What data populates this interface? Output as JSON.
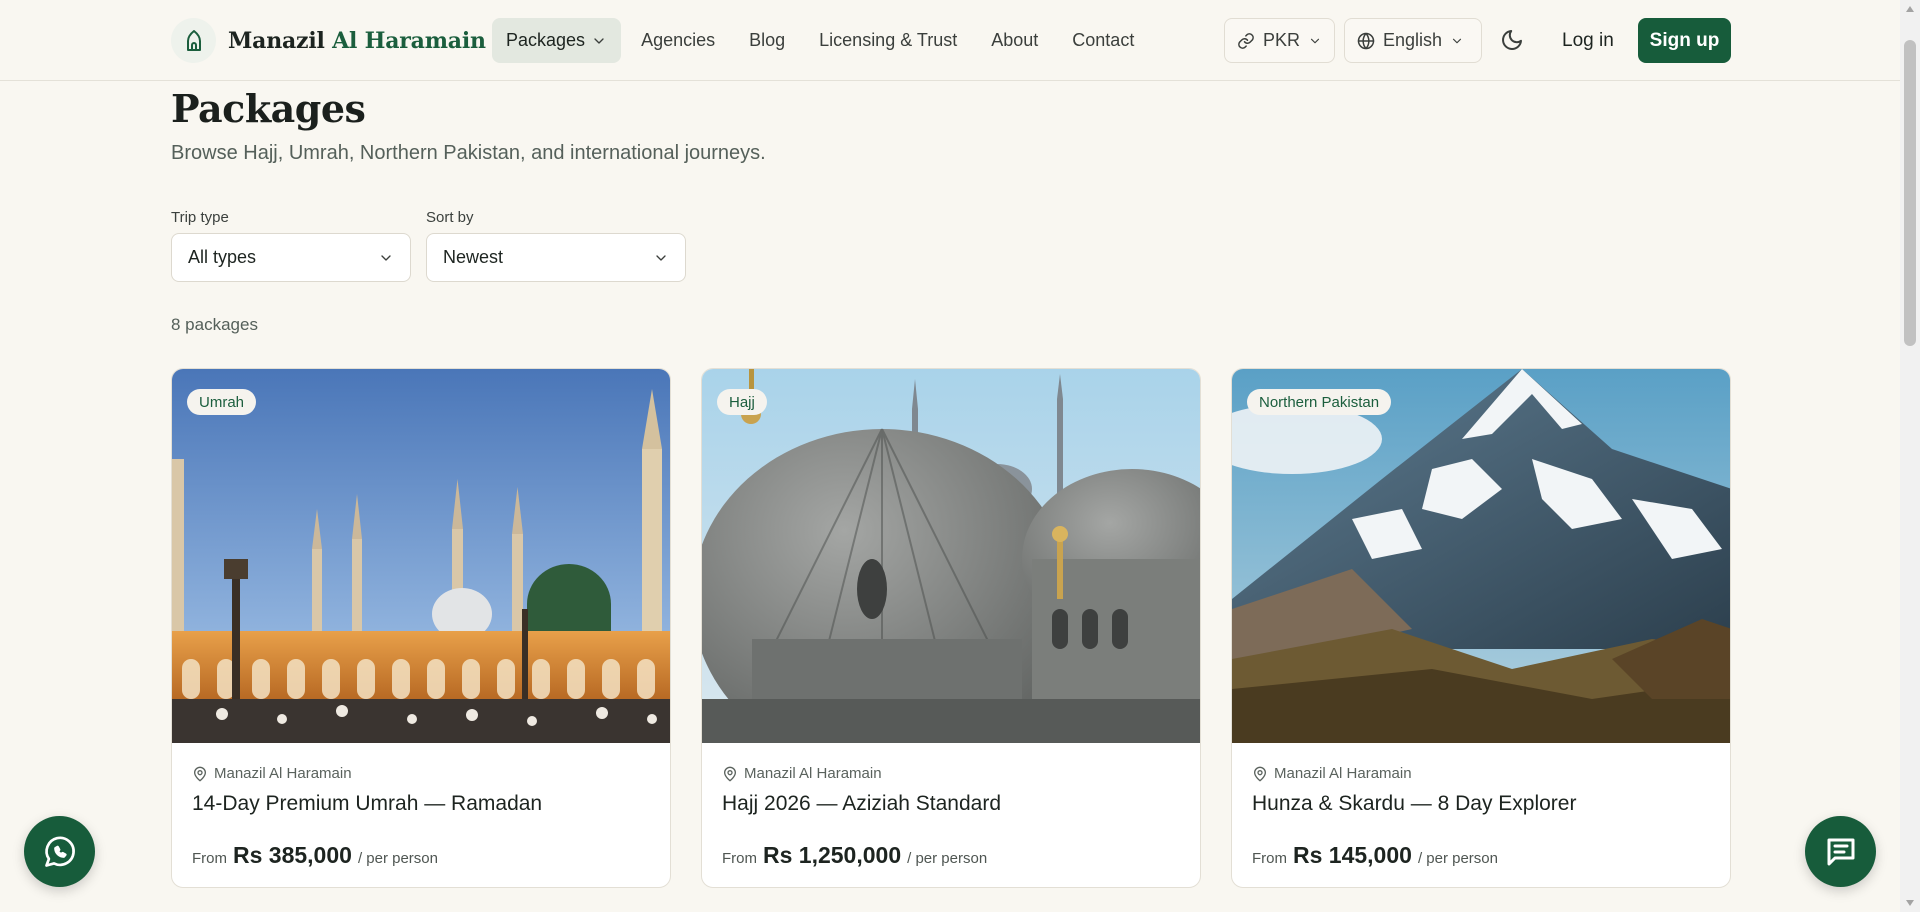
{
  "brand": {
    "name_part1": "Manazil",
    "name_part2": "Al Haramain"
  },
  "nav": {
    "items": [
      {
        "label": "Packages",
        "active": true
      },
      {
        "label": "Agencies"
      },
      {
        "label": "Blog"
      },
      {
        "label": "Licensing & Trust"
      },
      {
        "label": "About"
      },
      {
        "label": "Contact"
      }
    ]
  },
  "header": {
    "currency": "PKR",
    "language": "English",
    "login_label": "Log in",
    "signup_label": "Sign up"
  },
  "page": {
    "title": "Packages",
    "subtitle": "Browse Hajj, Umrah, Northern Pakistan, and international journeys."
  },
  "filters": {
    "trip_type": {
      "label": "Trip type",
      "value": "All types"
    },
    "sort_by": {
      "label": "Sort by",
      "value": "Newest"
    }
  },
  "results": {
    "count_text": "8 packages"
  },
  "cards": [
    {
      "badge": "Umrah",
      "agency": "Manazil Al Haramain",
      "title": "14-Day Premium Umrah — Ramadan",
      "from": "From",
      "price": "Rs 385,000",
      "per": "/ per person"
    },
    {
      "badge": "Hajj",
      "agency": "Manazil Al Haramain",
      "title": "Hajj 2026 — Aziziah Standard",
      "from": "From",
      "price": "Rs 1,250,000",
      "per": "/ per person"
    },
    {
      "badge": "Northern Pakistan",
      "agency": "Manazil Al Haramain",
      "title": "Hunza & Skardu — 8 Day Explorer",
      "from": "From",
      "price": "Rs 145,000",
      "per": "/ per person"
    }
  ],
  "colors": {
    "primary": "#175c3b",
    "background": "#f9f7f1",
    "accent_text": "#1b5e3d"
  },
  "icons": {
    "logo": "mosque-icon",
    "whatsapp": "whatsapp-icon",
    "chat": "chat-icon",
    "theme": "moon-icon"
  }
}
